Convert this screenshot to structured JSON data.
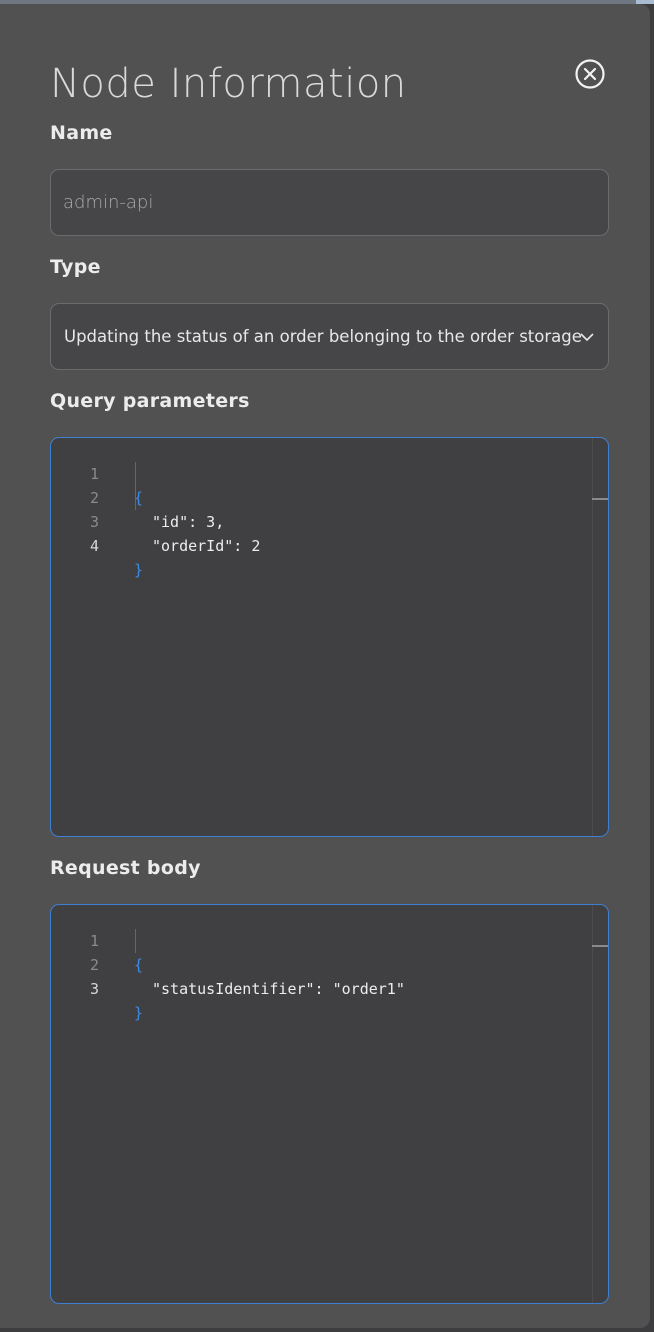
{
  "dialog": {
    "title": "Node Information"
  },
  "name_field": {
    "label": "Name",
    "value": "admin-api"
  },
  "type_field": {
    "label": "Type",
    "selected": "Updating the status of an order belonging to the order storage object"
  },
  "query_params": {
    "label": "Query parameters",
    "lines": [
      {
        "number": "1",
        "text": "{"
      },
      {
        "number": "2",
        "text": "\"id\": 3,"
      },
      {
        "number": "3",
        "text": "\"orderId\": 2"
      },
      {
        "number": "4",
        "text": "}"
      }
    ]
  },
  "request_body": {
    "label": "Request body",
    "lines": [
      {
        "number": "1",
        "text": "{"
      },
      {
        "number": "2",
        "text": "\"statusIdentifier\": \"order1\""
      },
      {
        "number": "3",
        "text": "}"
      }
    ]
  },
  "colors": {
    "panel": "#525152",
    "editor_border": "#3f7fd0",
    "brace": "#3b8ee8"
  },
  "icons": {
    "close": "close-circle-icon",
    "select": "chevron-down-icon"
  }
}
